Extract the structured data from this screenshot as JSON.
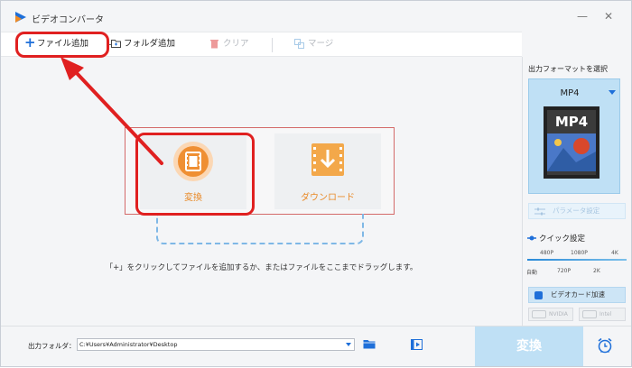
{
  "window": {
    "title": "ビデオコンバータ"
  },
  "toolbar": {
    "add_file": "ファイル追加",
    "add_folder": "フォルダ追加",
    "clear": "クリア",
    "merge": "マージ"
  },
  "main": {
    "convert_tile": "変換",
    "download_tile": "ダウンロード",
    "hint": "「+」をクリックしてファイルを追加するか、またはファイルをここまでドラッグします。"
  },
  "side": {
    "output_format_title": "出力フォーマットを選択",
    "format_name": "MP4",
    "format_thumb_text": "MP4",
    "param_settings": "パラメータ設定",
    "quick_settings": "クイック設定",
    "quality_top": [
      "480P",
      "1080P",
      "4K"
    ],
    "quality_bottom": [
      "自動",
      "720P",
      "2K"
    ],
    "gpu_accel": "ビデオカード加速",
    "vendor_nvidia": "NVIDIA",
    "vendor_intel": "Intel"
  },
  "bottom": {
    "output_folder_label": "出力フォルダ：",
    "output_path": "C:¥Users¥Administrator¥Desktop",
    "convert_button": "変換"
  },
  "colors": {
    "accent_blue": "#1e6fd9",
    "accent_orange": "#e98b2a",
    "annotation_red": "#e02020",
    "panel_blue": "#bfe0f5"
  }
}
